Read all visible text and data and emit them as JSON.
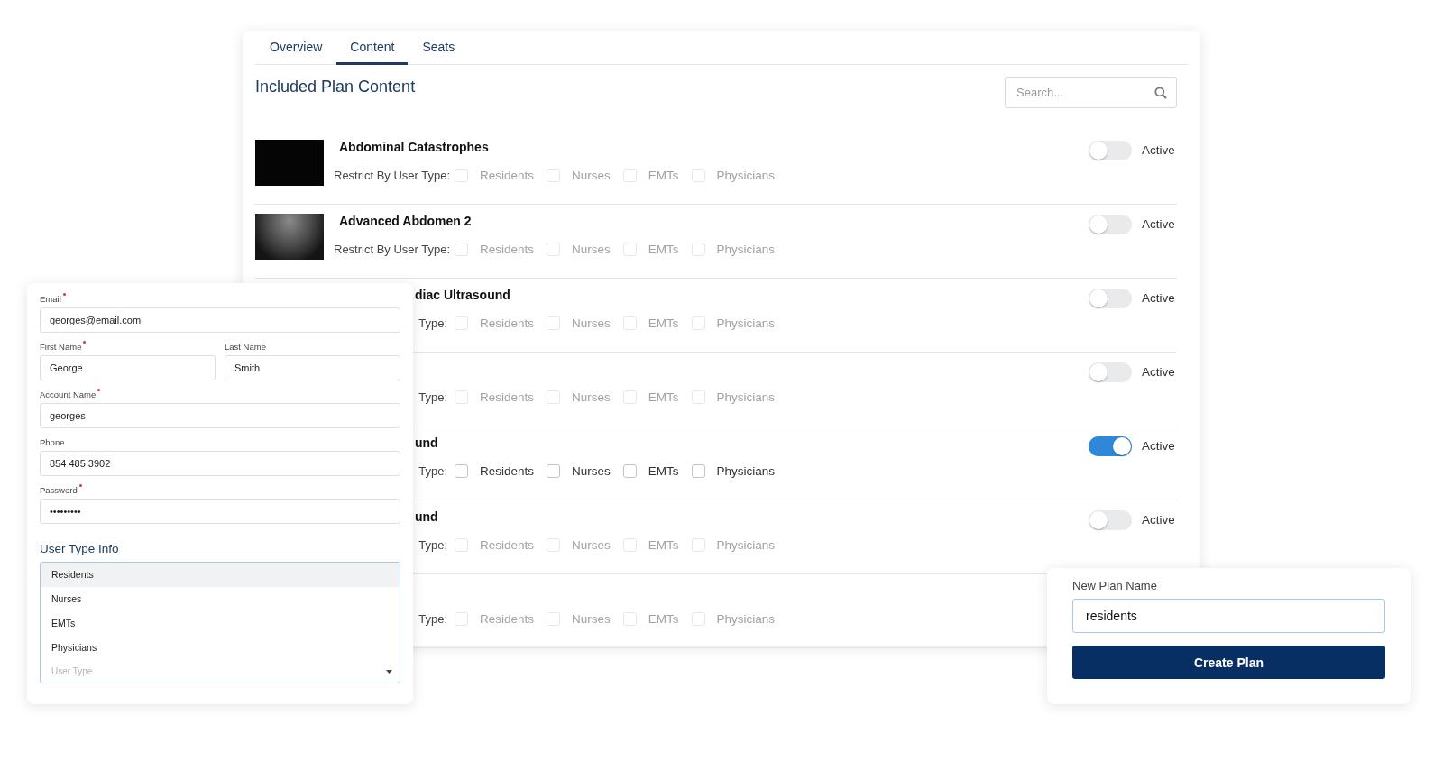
{
  "content_panel": {
    "tabs": [
      {
        "label": "Overview",
        "selected": false
      },
      {
        "label": "Content",
        "selected": true
      },
      {
        "label": "Seats",
        "selected": false
      }
    ],
    "heading": "Included Plan Content",
    "search": {
      "placeholder": "Search..."
    },
    "rows": [
      {
        "kind": "full",
        "thumbnail": {
          "kind": "slide"
        },
        "title": "Abdominal Catastrophes",
        "restrict_label": "Restrict By User Type:",
        "active": false,
        "toggle_label": "Active",
        "options_disabled": true,
        "options": [
          {
            "label": "Residents",
            "checked": false
          },
          {
            "label": "Nurses",
            "checked": false
          },
          {
            "label": "EMTs",
            "checked": false
          },
          {
            "label": "Physicians",
            "checked": false
          }
        ]
      },
      {
        "kind": "full",
        "thumbnail": {
          "kind": "ultrasound"
        },
        "title": "Advanced Abdomen 2",
        "restrict_label": "Restrict By User Type:",
        "active": false,
        "toggle_label": "Active",
        "options_disabled": true,
        "options": [
          {
            "label": "Residents",
            "checked": false
          },
          {
            "label": "Nurses",
            "checked": false
          },
          {
            "label": "EMTs",
            "checked": false
          },
          {
            "label": "Physicians",
            "checked": false
          }
        ]
      },
      {
        "kind": "covered",
        "title": "diac Ultrasound",
        "restrict_label": "Type:",
        "active": false,
        "toggle_label": "Active",
        "options_disabled": true,
        "options": [
          {
            "label": "Residents",
            "checked": false
          },
          {
            "label": "Nurses",
            "checked": false
          },
          {
            "label": "EMTs",
            "checked": false
          },
          {
            "label": "Physicians",
            "checked": false
          }
        ]
      },
      {
        "kind": "covered",
        "restrict_label": "Type:",
        "active": false,
        "toggle_label": "Active",
        "options_disabled": true,
        "options": [
          {
            "label": "Residents",
            "checked": false
          },
          {
            "label": "Nurses",
            "checked": false
          },
          {
            "label": "EMTs",
            "checked": false
          },
          {
            "label": "Physicians",
            "checked": false
          }
        ]
      },
      {
        "kind": "covered",
        "title": "und",
        "restrict_label": "Type:",
        "active": true,
        "toggle_label": "Active",
        "options_disabled": false,
        "options": [
          {
            "label": "Residents",
            "checked": false
          },
          {
            "label": "Nurses",
            "checked": false
          },
          {
            "label": "EMTs",
            "checked": false
          },
          {
            "label": "Physicians",
            "checked": false
          }
        ]
      },
      {
        "kind": "covered",
        "title": "und",
        "restrict_label": "Type:",
        "active": false,
        "toggle_label": "Active",
        "options_disabled": true,
        "options": [
          {
            "label": "Residents",
            "checked": false
          },
          {
            "label": "Nurses",
            "checked": false
          },
          {
            "label": "EMTs",
            "checked": false
          },
          {
            "label": "Physicians",
            "checked": false
          }
        ]
      },
      {
        "kind": "covered",
        "restrict_label": "Type:",
        "options_disabled": true,
        "options": [
          {
            "label": "Residents",
            "checked": false
          },
          {
            "label": "Nurses",
            "checked": false
          },
          {
            "label": "EMTs",
            "checked": false
          },
          {
            "label": "Physicians",
            "checked": false
          }
        ]
      }
    ]
  },
  "user_form": {
    "fields": [
      {
        "label": "Email",
        "required": true,
        "value": "georges@email.com",
        "kind": "full"
      },
      {
        "label": "First Name",
        "required": true,
        "value": "George",
        "kind": "half"
      },
      {
        "label": "Last Name",
        "required": false,
        "value": "Smith",
        "kind": "half"
      },
      {
        "label": "Account Name",
        "required": true,
        "value": "georges",
        "kind": "full"
      },
      {
        "label": "Phone",
        "required": false,
        "value": "854 485 3902",
        "kind": "full"
      },
      {
        "label": "Password",
        "required": true,
        "value": "•••••••••",
        "kind": "full"
      }
    ],
    "section_title": "User Type Info",
    "user_type_options": [
      {
        "label": "Residents",
        "selected": true
      },
      {
        "label": "Nurses",
        "selected": false
      },
      {
        "label": "EMTs",
        "selected": false
      },
      {
        "label": "Physicians",
        "selected": false
      }
    ],
    "user_type_select": {
      "placeholder": "User Type"
    }
  },
  "create_plan": {
    "label": "New Plan Name",
    "value": "residents",
    "button": "Create Plan"
  }
}
